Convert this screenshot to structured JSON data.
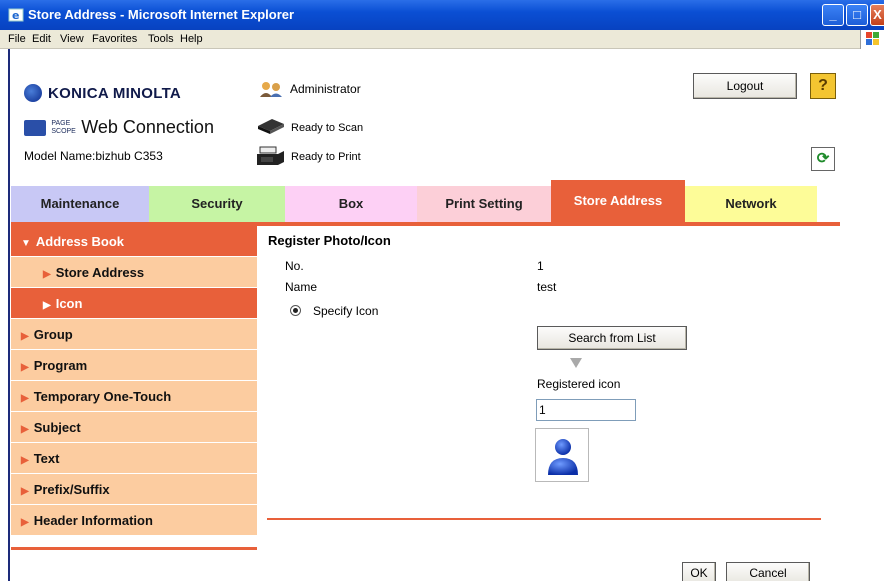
{
  "window": {
    "title": "Store Address - Microsoft Internet Explorer",
    "minimize": "_",
    "maximize": "□",
    "close": "X"
  },
  "menu": [
    "File",
    "Edit",
    "View",
    "Favorites",
    "Tools",
    "Help"
  ],
  "header": {
    "brand": "KONICA MINOLTA",
    "pagescope_top": "PAGE",
    "pagescope_bottom": "SCOPE",
    "web_connection": "Web Connection",
    "model_name": "Model Name:bizhub C353",
    "user": "Administrator",
    "scan_status": "Ready to Scan",
    "print_status": "Ready to Print",
    "logout": "Logout",
    "help": "?"
  },
  "tabs": [
    {
      "label": "Maintenance",
      "color": "#c8c8f5"
    },
    {
      "label": "Security",
      "color": "#c6f4a4"
    },
    {
      "label": "Box",
      "color": "#fdd0f5"
    },
    {
      "label": "Print Setting",
      "color": "#fccfd8"
    },
    {
      "label": "Store Address",
      "color": "#e8603a",
      "active": true
    },
    {
      "label": "Network",
      "color": "#fdfc98"
    }
  ],
  "sidebar": [
    {
      "label": "Address Book",
      "level": 0,
      "active": true,
      "arrow": "▼"
    },
    {
      "label": "Store Address",
      "level": 1,
      "arrow": "▶"
    },
    {
      "label": "Icon",
      "level": 1,
      "active": true,
      "arrow": "▶"
    },
    {
      "label": "Group",
      "level": 0,
      "arrow": "▶"
    },
    {
      "label": "Program",
      "level": 0,
      "arrow": "▶"
    },
    {
      "label": "Temporary One-Touch",
      "level": 0,
      "arrow": "▶"
    },
    {
      "label": "Subject",
      "level": 0,
      "arrow": "▶"
    },
    {
      "label": "Text",
      "level": 0,
      "arrow": "▶"
    },
    {
      "label": "Prefix/Suffix",
      "level": 0,
      "arrow": "▶"
    },
    {
      "label": "Header Information",
      "level": 0,
      "arrow": "▶"
    }
  ],
  "main": {
    "title": "Register Photo/Icon",
    "no_label": "No.",
    "no_value": "1",
    "name_label": "Name",
    "name_value": "test",
    "specify_icon": "Specify Icon",
    "search_button": "Search from List",
    "registered_icon_label": "Registered icon",
    "registered_icon_value": "1",
    "ok": "OK",
    "cancel": "Cancel"
  },
  "colors": {
    "accent": "#e8603a",
    "sidebar_bg": "#fccca0",
    "titlebar": "#0a4fd4"
  }
}
